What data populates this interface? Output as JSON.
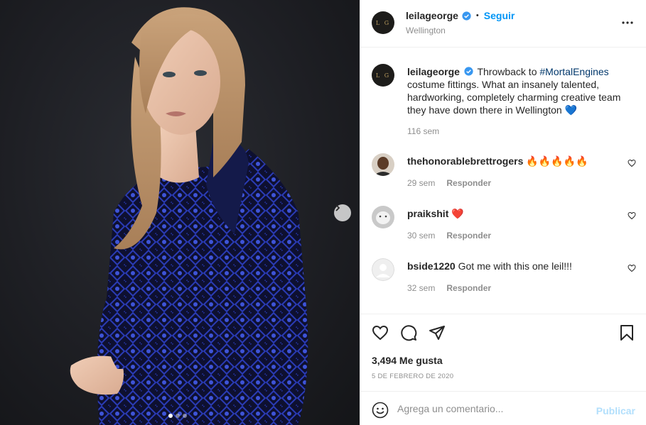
{
  "post": {
    "username": "leilageorge",
    "avatar_initials": "L G",
    "follow_label": "Seguir",
    "separator": "•",
    "location": "Wellington",
    "carousel_total": 3,
    "carousel_active": 1
  },
  "caption": {
    "username": "leilageorge",
    "text_before": "Throwback to ",
    "hashtag": "#MortalEngines",
    "text_after": " costume fittings. What an insanely talented, hardworking, completely charming creative team they have down there in Wellington 💙",
    "time": "116 sem"
  },
  "comments": [
    {
      "username": "thehonorablebrettrogers",
      "text": "🔥🔥🔥🔥🔥",
      "time": "29 sem",
      "reply": "Responder"
    },
    {
      "username": "praikshit",
      "text": "❤️",
      "time": "30 sem",
      "reply": "Responder"
    },
    {
      "username": "bside1220",
      "text": "Got me with this one leil!!!",
      "time": "32 sem",
      "reply": "Responder"
    }
  ],
  "stats": {
    "likes": "3,494 Me gusta",
    "date": "5 DE FEBRERO DE 2020"
  },
  "composer": {
    "placeholder": "Agrega un comentario...",
    "publish_label": "Publicar"
  },
  "colors": {
    "accent": "#0095f6",
    "publish_disabled": "#b2dffc",
    "hashtag": "#00376b",
    "muted": "#8e8e8e"
  },
  "icons": [
    "verified-badge-icon",
    "more-options-icon",
    "chevron-right-icon",
    "heart-icon",
    "comment-icon",
    "share-icon",
    "bookmark-icon",
    "emoji-icon"
  ]
}
